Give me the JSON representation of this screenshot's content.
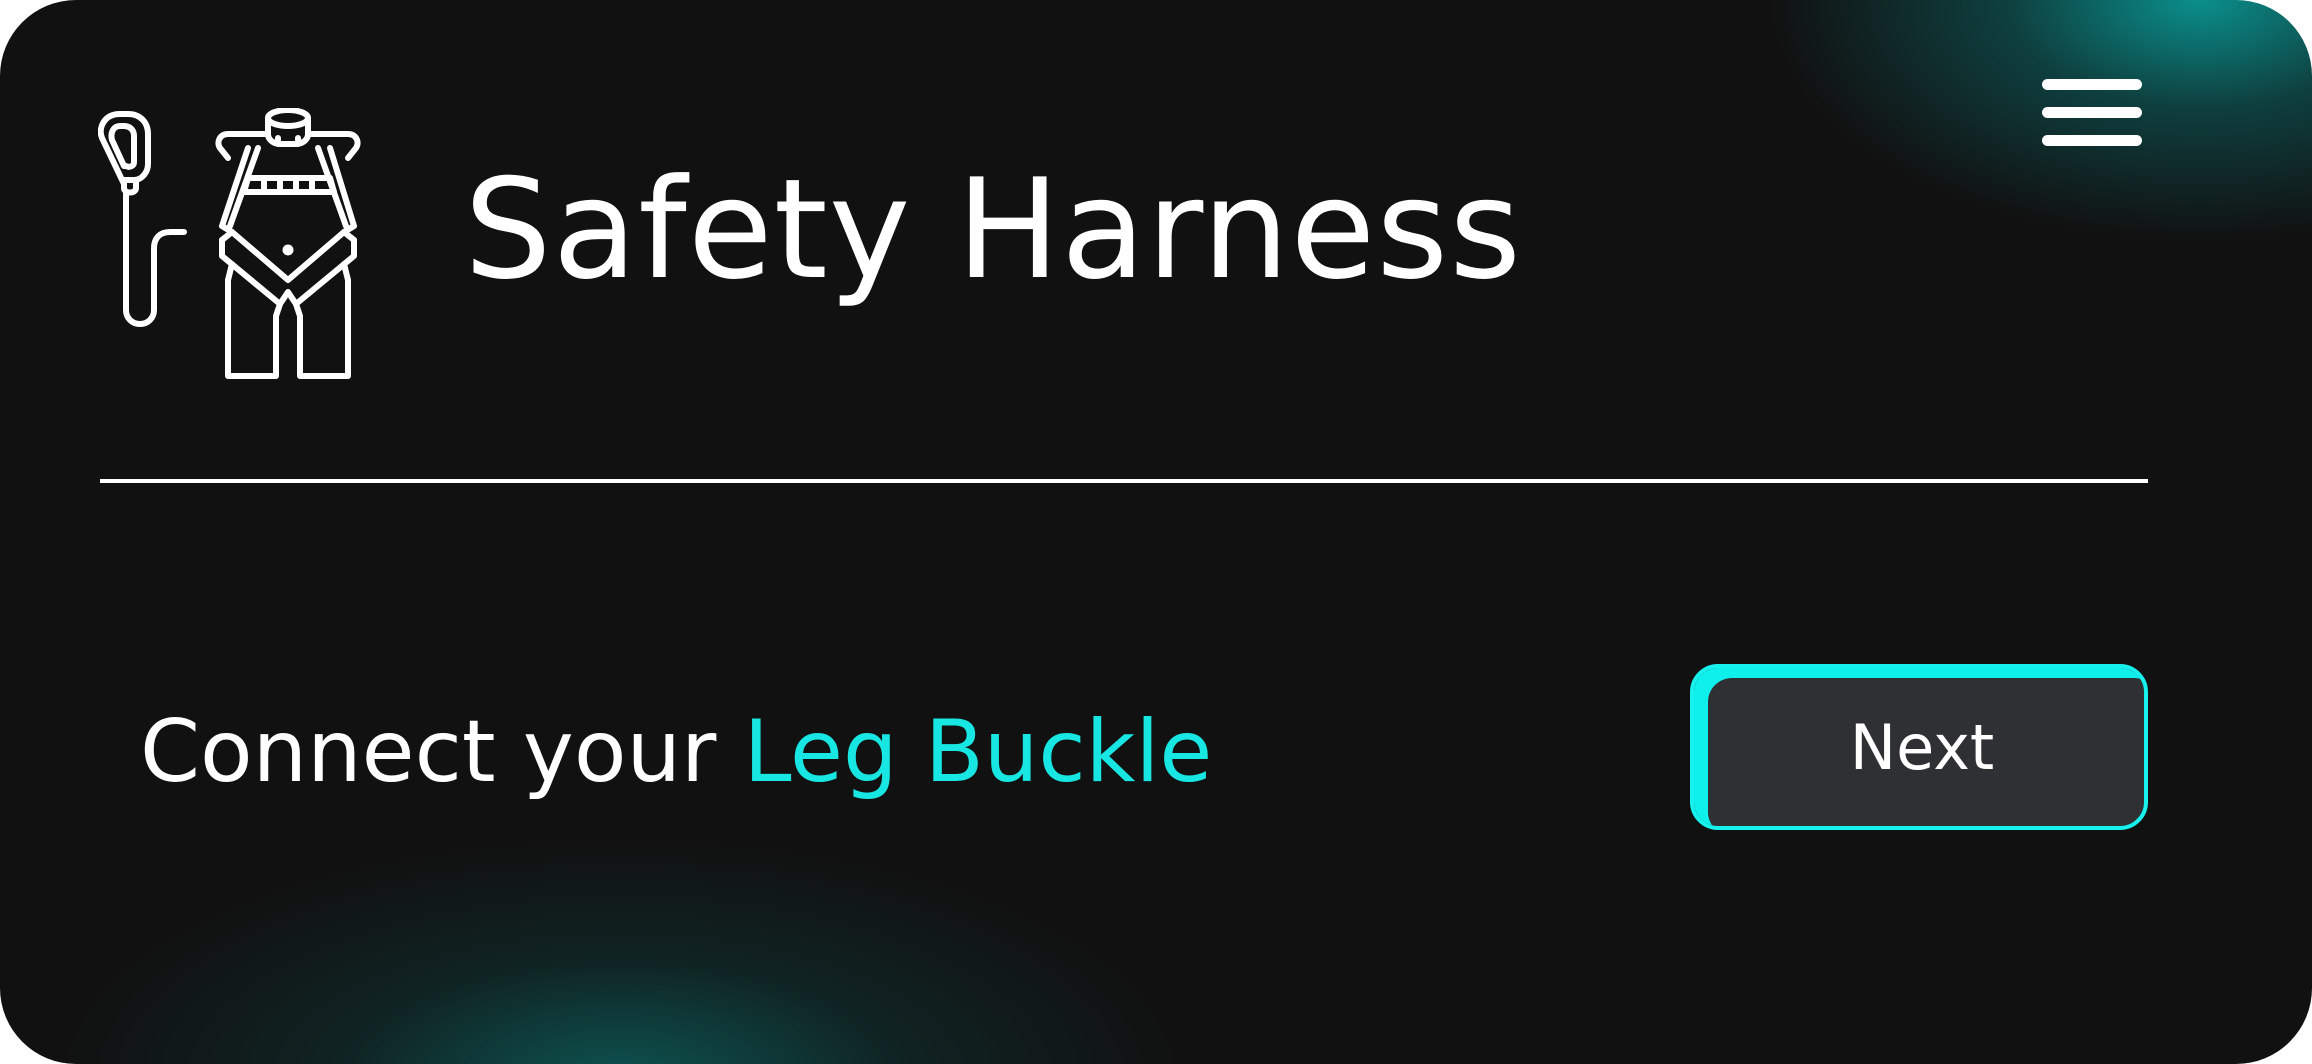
{
  "header": {
    "title": "Safety Harness",
    "icon": "safety-harness-icon",
    "menu_icon": "hamburger-menu-icon"
  },
  "instruction": {
    "prefix": "Connect your ",
    "highlight": "Leg Buckle"
  },
  "actions": {
    "next_label": "Next"
  },
  "colors": {
    "background": "#111111",
    "accent": "#18e6e2",
    "button_fill": "#2e3034",
    "text": "#ffffff"
  }
}
